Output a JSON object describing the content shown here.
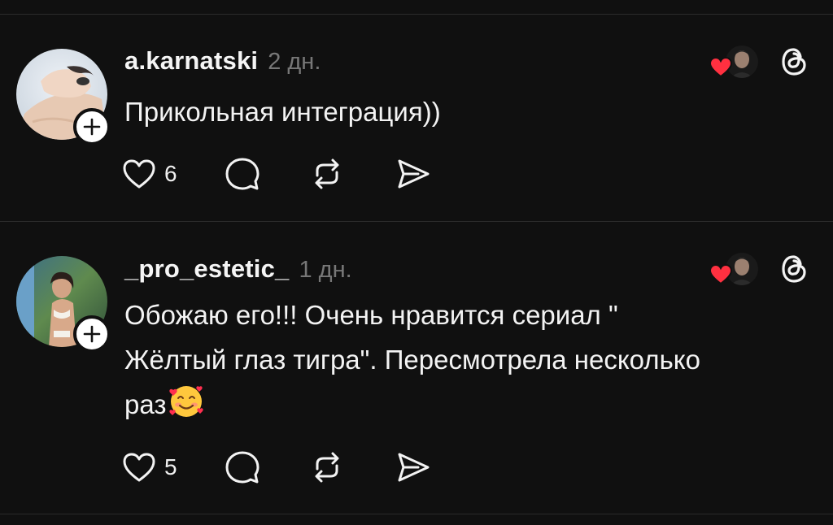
{
  "posts": [
    {
      "username": "a.karnatski",
      "timestamp": "2 дн.",
      "text": "Прикольная интеграция))",
      "like_count": "6",
      "emoji": ""
    },
    {
      "username": "_pro_estetic_",
      "timestamp": "1 дн.",
      "text": "Обожаю его!!! Очень нравится сериал \" Жёлтый глаз тигра\". Пересмотрела несколько раз",
      "like_count": "5",
      "emoji": "smiling-face-with-hearts"
    }
  ],
  "colors": {
    "background": "#101010",
    "divider": "#2b2b2b",
    "text": "#f3f3f3",
    "muted": "#777777",
    "heart": "#ff3040"
  },
  "icons": {
    "like": "heart-outline-icon",
    "comment": "comment-bubble-icon",
    "repost": "repost-icon",
    "share": "send-icon",
    "threads": "threads-logo-icon",
    "follow": "plus-icon"
  }
}
